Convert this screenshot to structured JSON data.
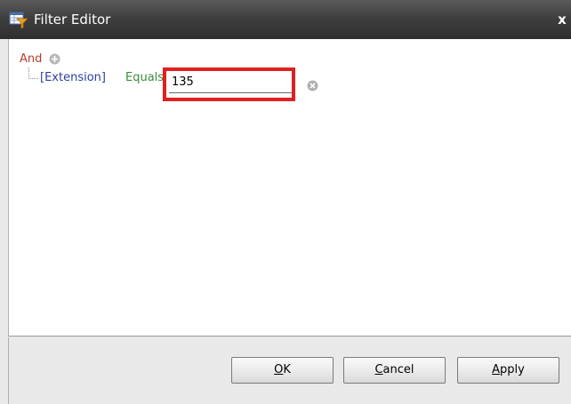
{
  "window": {
    "title": "Filter Editor",
    "close_glyph": "x",
    "title_icon": "filter-editor-icon"
  },
  "filter": {
    "group_operator": "And",
    "add_icon": "plus-circle-icon",
    "condition": {
      "field": "[Extension]",
      "operator": "Equals",
      "value": "135",
      "remove_icon": "remove-circle-icon"
    }
  },
  "buttons": {
    "ok_mnemonic": "O",
    "ok_rest": "K",
    "cancel_mnemonic": "C",
    "cancel_rest": "ancel",
    "apply_mnemonic": "A",
    "apply_rest": "pply"
  },
  "colors": {
    "group_operator": "#c0392b",
    "field": "#2c3e9e",
    "operator": "#3a8a3a",
    "highlight": "#e02020",
    "titlebar": "#3f3f3f"
  }
}
